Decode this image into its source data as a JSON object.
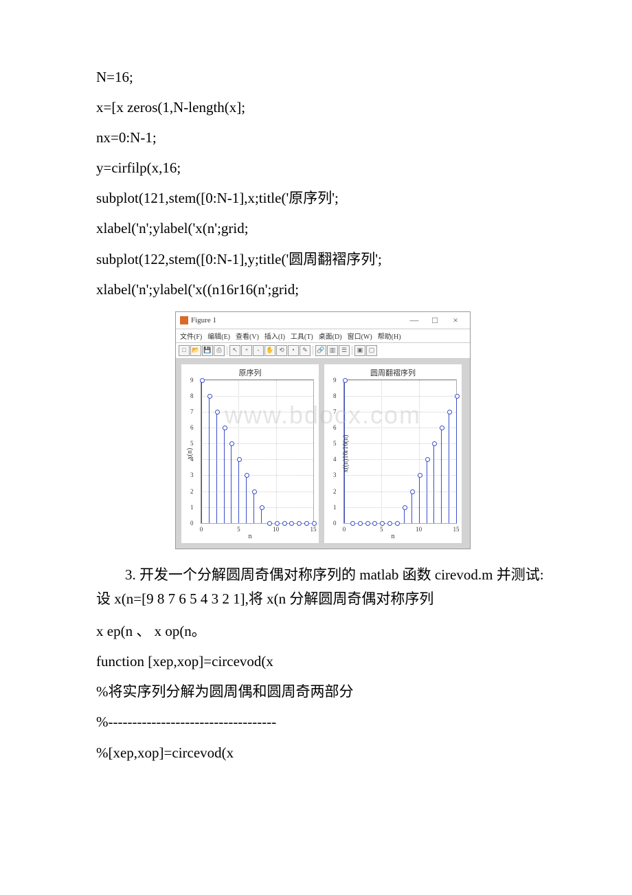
{
  "code": {
    "l1": "N=16;",
    "l2": "x=[x zeros(1,N-length(x];",
    "l3": "nx=0:N-1;",
    "l4": "y=cirfilp(x,16;",
    "l5": "subplot(121,stem([0:N-1],x;title('原序列';",
    "l6": "xlabel('n';ylabel('x(n';grid;",
    "l7": "subplot(122,stem([0:N-1],y;title('圆周翻褶序列';",
    "l8": "xlabel('n';ylabel('x((n16r16(n';grid;"
  },
  "figure": {
    "window_title": "Figure 1",
    "menus": [
      "文件(F)",
      "编辑(E)",
      "查看(V)",
      "插入(I)",
      "工具(T)",
      "桌面(D)",
      "窗口(W)",
      "帮助(H)"
    ],
    "plot1_title": "原序列",
    "plot2_title": "圆周翻褶序列",
    "xlabel": "n",
    "ylabel1": "x(n)",
    "ylabel2": "x((n)16r16(n)"
  },
  "chart_data": [
    {
      "type": "bar",
      "title": "原序列",
      "xlabel": "n",
      "ylabel": "x(n)",
      "categories": [
        0,
        1,
        2,
        3,
        4,
        5,
        6,
        7,
        8,
        9,
        10,
        11,
        12,
        13,
        14,
        15
      ],
      "values": [
        9,
        8,
        7,
        6,
        5,
        4,
        3,
        2,
        1,
        0,
        0,
        0,
        0,
        0,
        0,
        0
      ],
      "xlim": [
        0,
        15
      ],
      "ylim": [
        0,
        9
      ],
      "xticks": [
        0,
        5,
        10,
        15
      ],
      "yticks": [
        0,
        1,
        2,
        3,
        4,
        5,
        6,
        7,
        8,
        9
      ]
    },
    {
      "type": "bar",
      "title": "圆周翻褶序列",
      "xlabel": "n",
      "ylabel": "x((n)16r16(n)",
      "categories": [
        0,
        1,
        2,
        3,
        4,
        5,
        6,
        7,
        8,
        9,
        10,
        11,
        12,
        13,
        14,
        15
      ],
      "values": [
        9,
        0,
        0,
        0,
        0,
        0,
        0,
        0,
        1,
        2,
        3,
        4,
        5,
        6,
        7,
        8
      ],
      "xlim": [
        0,
        15
      ],
      "ylim": [
        0,
        9
      ],
      "xticks": [
        0,
        5,
        10,
        15
      ],
      "yticks": [
        0,
        1,
        2,
        3,
        4,
        5,
        6,
        7,
        8,
        9
      ]
    }
  ],
  "q3": {
    "prompt": "3. 开发一个分解圆周奇偶对称序列的 matlab 函数 cirevod.m 并测试:设 x(n=[9 8 7 6 5 4 3 2 1],将 x(n 分解圆周奇偶对称序列",
    "line1": "x ep(n 、 x op(n。",
    "line2": "function [xep,xop]=circevod(x",
    "line3": "%将实序列分解为圆周偶和圆周奇两部分",
    "line4": "%-----------------------------------",
    "line5": "%[xep,xop]=circevod(x"
  }
}
